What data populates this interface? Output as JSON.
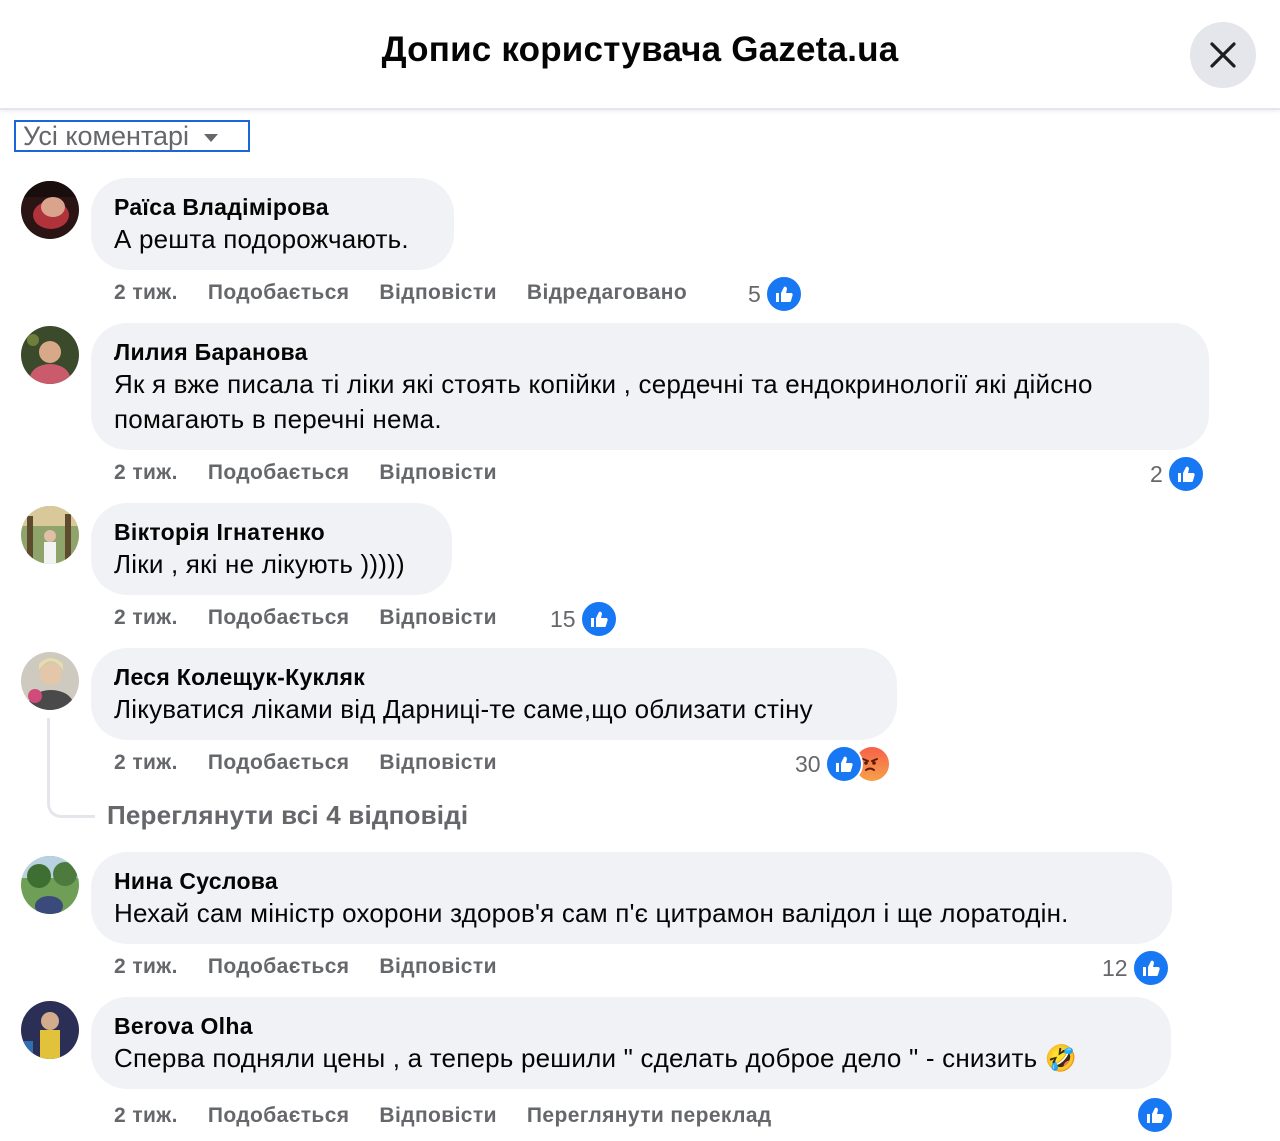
{
  "header": {
    "title": "Допис користувача Gazeta.ua"
  },
  "filter": {
    "label": "Усі коментарі"
  },
  "comments": [
    {
      "author": "Раїса Владімірова",
      "lines": [
        "А решта подорожчають."
      ],
      "time": "2 тиж.",
      "like": "Подобається",
      "reply": "Відповісти",
      "extra": "Відредаговано",
      "reactions": "5"
    },
    {
      "author": "Лилия Баранова",
      "lines": [
        "Як я вже писала ті ліки які стоять копійки , сердечні та ендокринології які дійсно",
        "помагають в перечні нема."
      ],
      "time": "2 тиж.",
      "like": "Подобається",
      "reply": "Відповісти",
      "reactions": "2"
    },
    {
      "author": "Вікторія Ігнатенко",
      "lines": [
        "Ліки , які не лікують )))))"
      ],
      "time": "2 тиж.",
      "like": "Подобається",
      "reply": "Відповісти",
      "reactions": "15"
    },
    {
      "author": "Леся Колещук-Кукляк",
      "lines": [
        "Лікуватися ліками від Дарниці-те саме,що облизати стіну"
      ],
      "time": "2 тиж.",
      "like": "Подобається",
      "reply": "Відповісти",
      "reactions": "30",
      "view_replies": "Переглянути всі 4 відповіді"
    },
    {
      "author": "Нина Суслова",
      "lines": [
        "Нехай сам міністр охорони здоров'я сам п'є цитрамон валідол і ще лоратодін."
      ],
      "time": "2 тиж.",
      "like": "Подобається",
      "reply": "Відповісти",
      "reactions": "12"
    },
    {
      "author": "Berova Olha",
      "lines": [
        "Сперва подняли цены , а теперь решили \" сделать доброе дело \" - снизить 🤣"
      ],
      "time": "2 тиж.",
      "like": "Подобається",
      "reply": "Відповісти",
      "extra": "Переглянути переклад",
      "reactions": ""
    }
  ],
  "colors": {
    "accent": "#1877f2",
    "bubble": "#f0f2f5",
    "secondary_text": "#65676b"
  },
  "icons": [
    "close-icon",
    "caret-down-icon",
    "like-icon",
    "angry-icon"
  ]
}
